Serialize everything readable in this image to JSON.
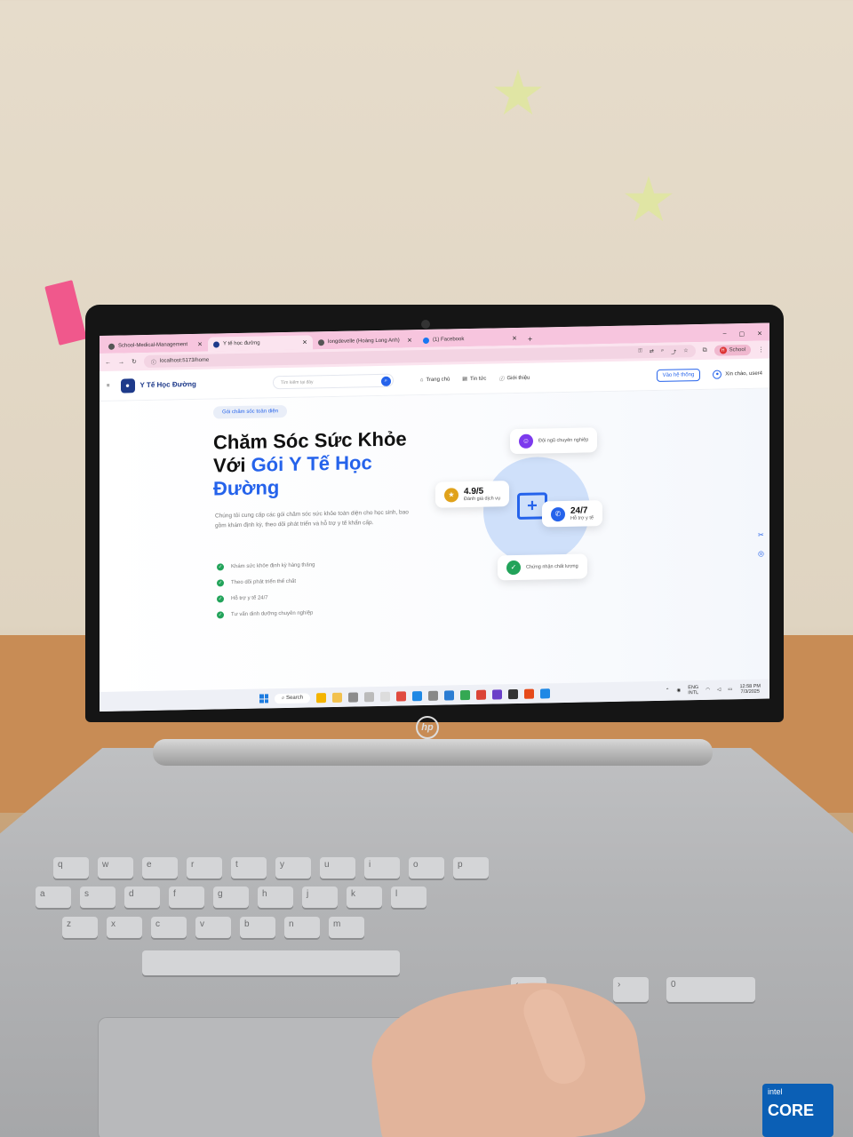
{
  "browser": {
    "tabs": [
      {
        "label": "School-Medical-Management",
        "active": false
      },
      {
        "label": "Y tế học đường",
        "active": true
      },
      {
        "label": "longdevelle (Hoàng Long Anh)",
        "active": false
      },
      {
        "label": "(1) Facebook",
        "active": false
      }
    ],
    "new_tab": "+",
    "window_controls": [
      "–",
      "▢",
      "✕"
    ],
    "url": "localhost:5173/home",
    "profile_label": "School",
    "profile_initial": "H"
  },
  "site": {
    "brand_name": "Y Tế Học Đường",
    "search_placeholder": "Tìm kiếm tại đây",
    "nav": [
      "Trang chủ",
      "Tin tức",
      "Giới thiệu"
    ],
    "contact_button": "Vào hệ thống",
    "user_greeting": "Xin chào, user4"
  },
  "hero": {
    "badge": "Gói chăm sóc toàn diện",
    "title_part1": "Chăm Sóc Sức Khỏe Với",
    "title_highlight": "Gói Y Tế Học Đường",
    "description": "Chúng tôi cung cấp các gói chăm sóc sức khỏe toàn diện cho học sinh, bao gồm khám định kỳ, theo dõi phát triển và hỗ trợ y tế khẩn cấp.",
    "features": [
      "Khám sức khỏe định kỳ hàng tháng",
      "Theo dõi phát triển thể chất",
      "Hỗ trợ y tế 24/7",
      "Tư vấn dinh dưỡng chuyên nghiệp"
    ],
    "cards": {
      "team": "Đội ngũ chuyên nghiệp",
      "rating_value": "4.9/5",
      "rating_label": "Đánh giá dịch vụ",
      "support_value": "24/7",
      "support_label": "Hỗ trợ y tế",
      "quality": "Chứng nhận chất lượng"
    }
  },
  "taskbar": {
    "search": "Search",
    "lang": "ENG",
    "lang_sub": "INTL",
    "time": "12:58 PM",
    "date": "7/3/2025"
  },
  "hardware": {
    "brand": "hp",
    "cpu_badge_top": "intel",
    "cpu_badge": "CORE"
  },
  "colors": {
    "accent": "#2563eb",
    "brand_dark": "#1e3a8a",
    "browser_tabbar": "#f7c5de",
    "check_green": "#22a35a"
  }
}
